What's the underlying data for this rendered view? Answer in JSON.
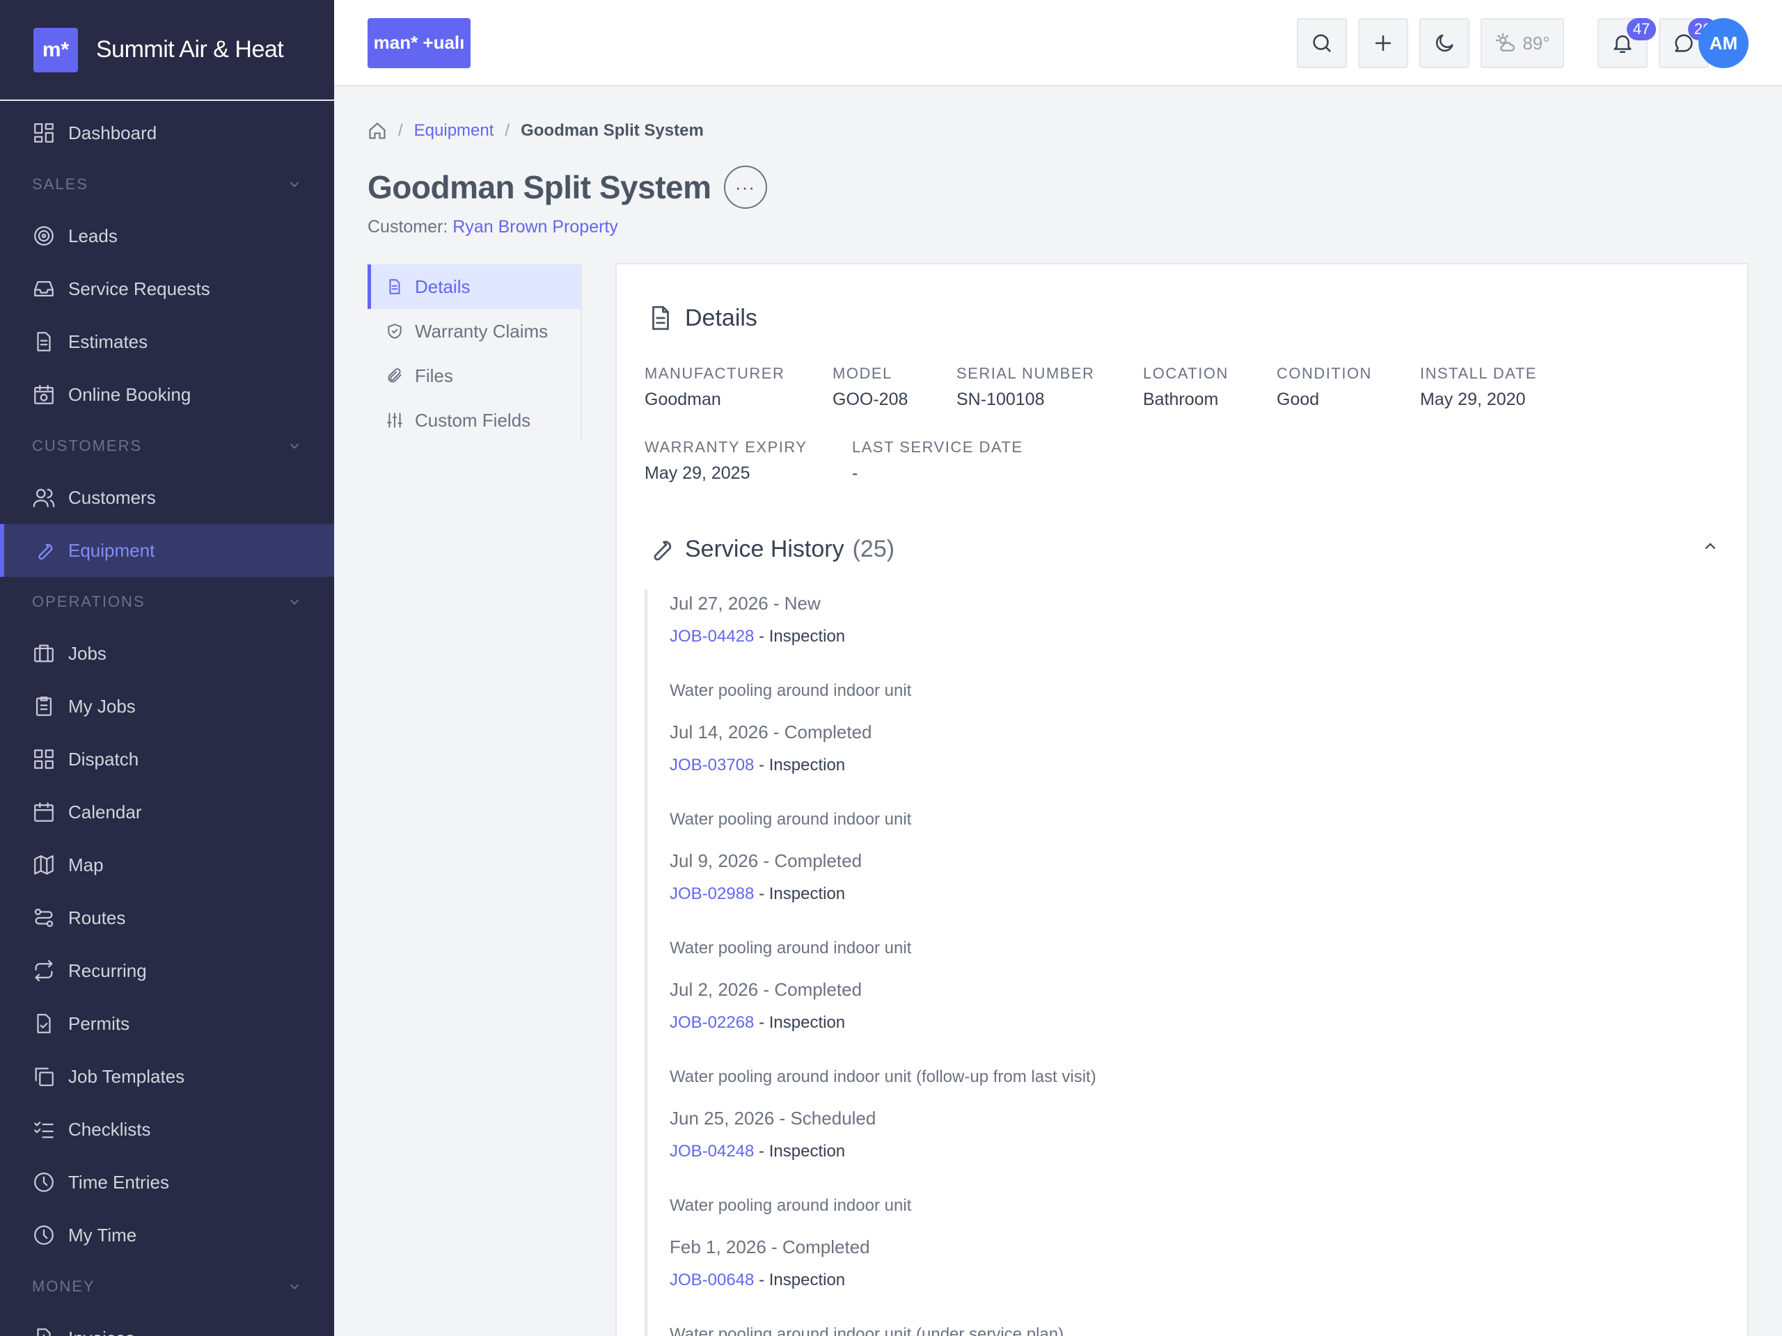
{
  "brand": {
    "logo": "m*",
    "name": "Summit Air & Heat"
  },
  "sidebar": {
    "dashboard": "Dashboard",
    "sales": {
      "title": "SALES",
      "items": [
        "Leads",
        "Service Requests",
        "Estimates",
        "Online Booking"
      ]
    },
    "customers": {
      "title": "CUSTOMERS",
      "items": [
        "Customers",
        "Equipment"
      ]
    },
    "operations": {
      "title": "OPERATIONS",
      "items": [
        "Jobs",
        "My Jobs",
        "Dispatch",
        "Calendar",
        "Map",
        "Routes",
        "Recurring",
        "Permits",
        "Job Templates",
        "Checklists",
        "Time Entries",
        "My Time"
      ]
    },
    "money": {
      "title": "MONEY",
      "items": [
        "Invoices"
      ]
    }
  },
  "topbar": {
    "logo": "man* +ualı",
    "weather": "89°",
    "notifications_count": "47",
    "messages_count": "26",
    "avatar": "AM"
  },
  "breadcrumb": {
    "parent": "Equipment",
    "current": "Goodman Split System"
  },
  "page": {
    "title": "Goodman Split System",
    "more": "···",
    "customer_label": "Customer:",
    "customer_name": "Ryan Brown Property"
  },
  "tabs": [
    "Details",
    "Warranty Claims",
    "Files",
    "Custom Fields"
  ],
  "details": {
    "title": "Details",
    "fields": [
      {
        "label": "MANUFACTURER",
        "value": "Goodman"
      },
      {
        "label": "MODEL",
        "value": "GOO-208"
      },
      {
        "label": "SERIAL NUMBER",
        "value": "SN-100108"
      },
      {
        "label": "LOCATION",
        "value": "Bathroom"
      },
      {
        "label": "CONDITION",
        "value": "Good"
      },
      {
        "label": "INSTALL DATE",
        "value": "May 29, 2020"
      },
      {
        "label": "WARRANTY EXPIRY",
        "value": "May 29, 2025"
      },
      {
        "label": "LAST SERVICE DATE",
        "value": "-"
      }
    ]
  },
  "service_history": {
    "title": "Service History",
    "count": "(25)",
    "entries": [
      {
        "date": "Jul 27, 2026",
        "status": "New",
        "job": "JOB-04428",
        "type": "Inspection",
        "note": "Water pooling around indoor unit"
      },
      {
        "date": "Jul 14, 2026",
        "status": "Completed",
        "job": "JOB-03708",
        "type": "Inspection",
        "note": "Water pooling around indoor unit"
      },
      {
        "date": "Jul 9, 2026",
        "status": "Completed",
        "job": "JOB-02988",
        "type": "Inspection",
        "note": "Water pooling around indoor unit"
      },
      {
        "date": "Jul 2, 2026",
        "status": "Completed",
        "job": "JOB-02268",
        "type": "Inspection",
        "note": "Water pooling around indoor unit (follow-up from last visit)"
      },
      {
        "date": "Jun 25, 2026",
        "status": "Scheduled",
        "job": "JOB-04248",
        "type": "Inspection",
        "note": "Water pooling around indoor unit"
      },
      {
        "date": "Feb 1, 2026",
        "status": "Completed",
        "job": "JOB-00648",
        "type": "Inspection",
        "note": "Water pooling around indoor unit (under service plan)"
      }
    ]
  }
}
